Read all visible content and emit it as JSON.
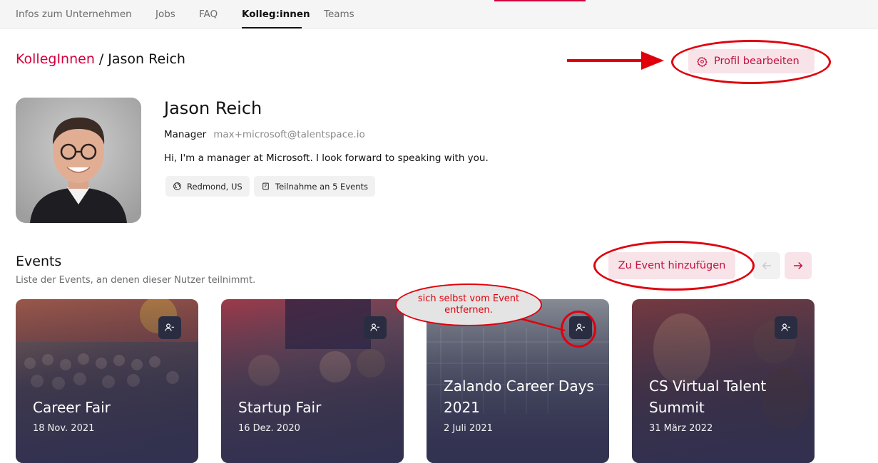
{
  "topnav": {
    "tabs": [
      {
        "label": "Infos zum Unternehmen"
      },
      {
        "label": "Jobs"
      },
      {
        "label": "FAQ"
      },
      {
        "label": "Kolleg:innen",
        "active": true
      },
      {
        "label": "Teams"
      }
    ]
  },
  "breadcrumb": {
    "parent": "KollegInnen",
    "separator": "/",
    "current": "Jason Reich"
  },
  "profile": {
    "edit_label": "Profil bearbeiten",
    "edit_icon": "gear-icon",
    "name": "Jason Reich",
    "role": "Manager",
    "email": "max+microsoft@talentspace.io",
    "bio": "Hi, I'm a manager at Microsoft. I look forward to speaking with you.",
    "location": "Redmond, US",
    "location_icon": "globe-icon",
    "events_participation": "Teilnahme an 5 Events",
    "events_icon": "calendar-icon"
  },
  "events": {
    "title": "Events",
    "subtitle": "Liste der Events, an denen dieser Nutzer teilnimmt.",
    "add_label": "Zu Event hinzufügen",
    "prev_icon": "arrow-left-icon",
    "next_icon": "arrow-right-icon",
    "cards": [
      {
        "title": "Career Fair",
        "date": "18 Nov. 2021",
        "remove_icon": "user-minus-icon"
      },
      {
        "title": "Startup Fair",
        "date": "16 Dez. 2020",
        "remove_icon": "user-minus-icon"
      },
      {
        "title": "Zalando Career Days 2021",
        "date": "2 Juli 2021",
        "remove_icon": "user-minus-icon"
      },
      {
        "title": "CS Virtual Talent Summit",
        "date": "31 März 2022",
        "remove_icon": "user-minus-icon"
      }
    ]
  },
  "annotation": {
    "callout_text": "sich selbst vom Event entfernen.",
    "color": "#e0000c"
  },
  "colors": {
    "accent": "#d1003b",
    "button_bg": "#f7e3e8",
    "card_overlay": "#2f3050"
  }
}
